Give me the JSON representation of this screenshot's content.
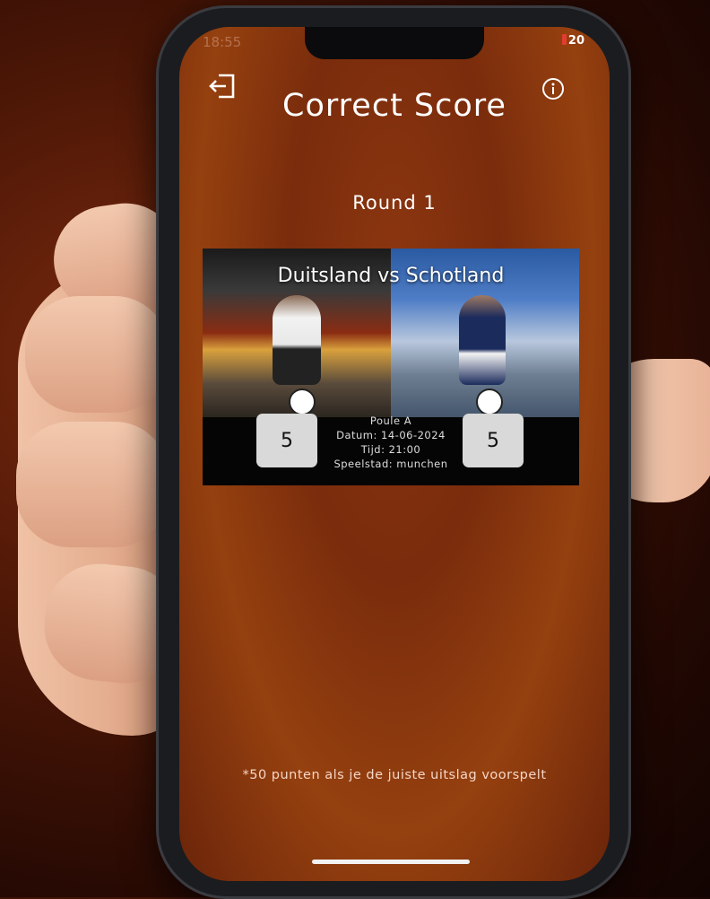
{
  "status_bar": {
    "time": "18:55",
    "battery": "20"
  },
  "header": {
    "title": "Correct Score",
    "exit_icon": "exit-icon",
    "info_icon": "info-icon"
  },
  "round": {
    "label": "Round 1"
  },
  "match": {
    "title": "Duitsland vs Schotland",
    "home_score": "5",
    "away_score": "5",
    "poule": "Poule A",
    "datum": "Datum: 14-06-2024",
    "tijd": "Tijd: 21:00",
    "speelstad": "Speelstad: munchen"
  },
  "footer": {
    "note": "*50 punten als je de juiste uitslag voorspelt"
  },
  "colors": {
    "accent_bg": "#8c3610",
    "score_box": "#d9d9d9",
    "text": "#ffffff",
    "battery_low": "#e23b2f"
  }
}
